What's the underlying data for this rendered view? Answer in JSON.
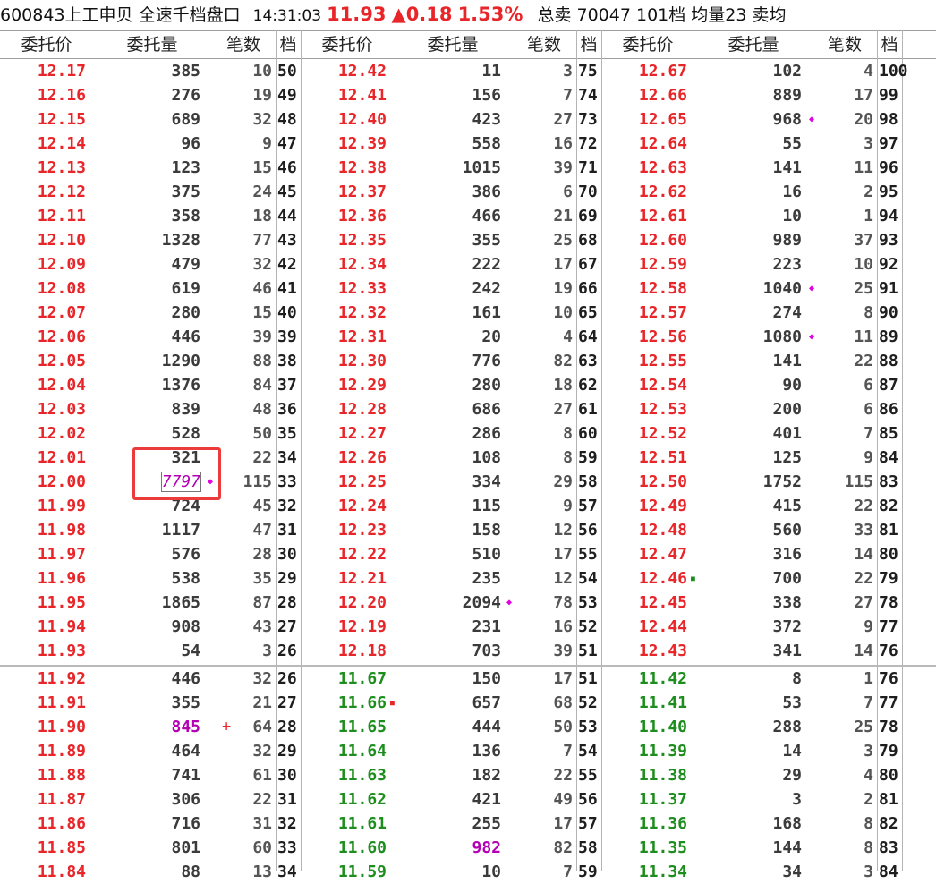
{
  "header": {
    "code": "600843",
    "name": "上工申贝",
    "mode": "全速千档盘口",
    "time": "14:31:03",
    "price": "11.93",
    "change": "▲0.18",
    "pct": "1.53%",
    "info": "总卖 70047 101档 均量23 卖均"
  },
  "columns": {
    "price": "委托价",
    "qty": "委托量",
    "count": "笔数",
    "level": "档"
  },
  "asks": [
    [
      [
        "12.17",
        "385",
        "10",
        "50"
      ],
      [
        "12.42",
        "11",
        "3",
        "75"
      ],
      [
        "12.67",
        "102",
        "4",
        "100"
      ]
    ],
    [
      [
        "12.16",
        "276",
        "19",
        "49"
      ],
      [
        "12.41",
        "156",
        "7",
        "74"
      ],
      [
        "12.66",
        "889",
        "17",
        "99"
      ]
    ],
    [
      [
        "12.15",
        "689",
        "32",
        "48"
      ],
      [
        "12.40",
        "423",
        "27",
        "73"
      ],
      [
        "12.65",
        "968",
        "20",
        "98"
      ]
    ],
    [
      [
        "12.14",
        "96",
        "9",
        "47"
      ],
      [
        "12.39",
        "558",
        "16",
        "72"
      ],
      [
        "12.64",
        "55",
        "3",
        "97"
      ]
    ],
    [
      [
        "12.13",
        "123",
        "15",
        "46"
      ],
      [
        "12.38",
        "1015",
        "39",
        "71"
      ],
      [
        "12.63",
        "141",
        "11",
        "96"
      ]
    ],
    [
      [
        "12.12",
        "375",
        "24",
        "45"
      ],
      [
        "12.37",
        "386",
        "6",
        "70"
      ],
      [
        "12.62",
        "16",
        "2",
        "95"
      ]
    ],
    [
      [
        "12.11",
        "358",
        "18",
        "44"
      ],
      [
        "12.36",
        "466",
        "21",
        "69"
      ],
      [
        "12.61",
        "10",
        "1",
        "94"
      ]
    ],
    [
      [
        "12.10",
        "1328",
        "77",
        "43"
      ],
      [
        "12.35",
        "355",
        "25",
        "68"
      ],
      [
        "12.60",
        "989",
        "37",
        "93"
      ]
    ],
    [
      [
        "12.09",
        "479",
        "32",
        "42"
      ],
      [
        "12.34",
        "222",
        "17",
        "67"
      ],
      [
        "12.59",
        "223",
        "10",
        "92"
      ]
    ],
    [
      [
        "12.08",
        "619",
        "46",
        "41"
      ],
      [
        "12.33",
        "242",
        "19",
        "66"
      ],
      [
        "12.58",
        "1040",
        "25",
        "91"
      ]
    ],
    [
      [
        "12.07",
        "280",
        "15",
        "40"
      ],
      [
        "12.32",
        "161",
        "10",
        "65"
      ],
      [
        "12.57",
        "274",
        "8",
        "90"
      ]
    ],
    [
      [
        "12.06",
        "446",
        "39",
        "39"
      ],
      [
        "12.31",
        "20",
        "4",
        "64"
      ],
      [
        "12.56",
        "1080",
        "11",
        "89"
      ]
    ],
    [
      [
        "12.05",
        "1290",
        "88",
        "38"
      ],
      [
        "12.30",
        "776",
        "82",
        "63"
      ],
      [
        "12.55",
        "141",
        "22",
        "88"
      ]
    ],
    [
      [
        "12.04",
        "1376",
        "84",
        "37"
      ],
      [
        "12.29",
        "280",
        "18",
        "62"
      ],
      [
        "12.54",
        "90",
        "6",
        "87"
      ]
    ],
    [
      [
        "12.03",
        "839",
        "48",
        "36"
      ],
      [
        "12.28",
        "686",
        "27",
        "61"
      ],
      [
        "12.53",
        "200",
        "6",
        "86"
      ]
    ],
    [
      [
        "12.02",
        "528",
        "50",
        "35"
      ],
      [
        "12.27",
        "286",
        "8",
        "60"
      ],
      [
        "12.52",
        "401",
        "7",
        "85"
      ]
    ],
    [
      [
        "12.01",
        "321",
        "22",
        "34"
      ],
      [
        "12.26",
        "108",
        "8",
        "59"
      ],
      [
        "12.51",
        "125",
        "9",
        "84"
      ]
    ],
    [
      [
        "12.00",
        "7797",
        "115",
        "33"
      ],
      [
        "12.25",
        "334",
        "29",
        "58"
      ],
      [
        "12.50",
        "1752",
        "115",
        "83"
      ]
    ],
    [
      [
        "11.99",
        "724",
        "45",
        "32"
      ],
      [
        "12.24",
        "115",
        "9",
        "57"
      ],
      [
        "12.49",
        "415",
        "22",
        "82"
      ]
    ],
    [
      [
        "11.98",
        "1117",
        "47",
        "31"
      ],
      [
        "12.23",
        "158",
        "12",
        "56"
      ],
      [
        "12.48",
        "560",
        "33",
        "81"
      ]
    ],
    [
      [
        "11.97",
        "576",
        "28",
        "30"
      ],
      [
        "12.22",
        "510",
        "17",
        "55"
      ],
      [
        "12.47",
        "316",
        "14",
        "80"
      ]
    ],
    [
      [
        "11.96",
        "538",
        "35",
        "29"
      ],
      [
        "12.21",
        "235",
        "12",
        "54"
      ],
      [
        "12.46",
        "700",
        "22",
        "79"
      ]
    ],
    [
      [
        "11.95",
        "1865",
        "87",
        "28"
      ],
      [
        "12.20",
        "2094",
        "78",
        "53"
      ],
      [
        "12.45",
        "338",
        "27",
        "78"
      ]
    ],
    [
      [
        "11.94",
        "908",
        "43",
        "27"
      ],
      [
        "12.19",
        "231",
        "16",
        "52"
      ],
      [
        "12.44",
        "372",
        "9",
        "77"
      ]
    ],
    [
      [
        "11.93",
        "54",
        "3",
        "26"
      ],
      [
        "12.18",
        "703",
        "39",
        "51"
      ],
      [
        "12.43",
        "341",
        "14",
        "76"
      ]
    ]
  ],
  "bids": [
    [
      [
        "11.92",
        "446",
        "32",
        "26"
      ],
      [
        "11.67",
        "150",
        "17",
        "51"
      ],
      [
        "11.42",
        "8",
        "1",
        "76"
      ]
    ],
    [
      [
        "11.91",
        "355",
        "21",
        "27"
      ],
      [
        "11.66",
        "657",
        "68",
        "52"
      ],
      [
        "11.41",
        "53",
        "7",
        "77"
      ]
    ],
    [
      [
        "11.90",
        "845",
        "64",
        "28"
      ],
      [
        "11.65",
        "444",
        "50",
        "53"
      ],
      [
        "11.40",
        "288",
        "25",
        "78"
      ]
    ],
    [
      [
        "11.89",
        "464",
        "32",
        "29"
      ],
      [
        "11.64",
        "136",
        "7",
        "54"
      ],
      [
        "11.39",
        "14",
        "3",
        "79"
      ]
    ],
    [
      [
        "11.88",
        "741",
        "61",
        "30"
      ],
      [
        "11.63",
        "182",
        "22",
        "55"
      ],
      [
        "11.38",
        "29",
        "4",
        "80"
      ]
    ],
    [
      [
        "11.87",
        "306",
        "22",
        "31"
      ],
      [
        "11.62",
        "421",
        "49",
        "56"
      ],
      [
        "11.37",
        "3",
        "2",
        "81"
      ]
    ],
    [
      [
        "11.86",
        "716",
        "31",
        "32"
      ],
      [
        "11.61",
        "255",
        "17",
        "57"
      ],
      [
        "11.36",
        "168",
        "8",
        "82"
      ]
    ],
    [
      [
        "11.85",
        "801",
        "60",
        "33"
      ],
      [
        "11.60",
        "982",
        "82",
        "58"
      ],
      [
        "11.35",
        "144",
        "8",
        "83"
      ]
    ],
    [
      [
        "11.84",
        "88",
        "13",
        "34"
      ],
      [
        "11.59",
        "10",
        "7",
        "59"
      ],
      [
        "11.34",
        "34",
        "3",
        "84"
      ]
    ]
  ],
  "markers": [
    {
      "side": "asks",
      "row": 2,
      "grp": 2,
      "type": "diamond"
    },
    {
      "side": "asks",
      "row": 9,
      "grp": 2,
      "type": "diamond"
    },
    {
      "side": "asks",
      "row": 11,
      "grp": 2,
      "type": "diamond"
    },
    {
      "side": "asks",
      "row": 17,
      "grp": 0,
      "type": "diamond"
    },
    {
      "side": "asks",
      "row": 21,
      "grp": 2,
      "type": "green-square"
    },
    {
      "side": "asks",
      "row": 22,
      "grp": 1,
      "type": "diamond"
    },
    {
      "side": "bids",
      "row": 1,
      "grp": 1,
      "type": "red-square"
    },
    {
      "side": "bids",
      "row": 2,
      "grp": 0,
      "type": "plus"
    }
  ],
  "magenta_qty": [
    {
      "side": "asks",
      "row": 17,
      "grp": 0
    },
    {
      "side": "bids",
      "row": 2,
      "grp": 0
    },
    {
      "side": "bids",
      "row": 7,
      "grp": 1
    }
  ],
  "boxed_qty": [
    {
      "side": "asks",
      "row": 17,
      "grp": 0
    }
  ],
  "colors": {
    "up": "#e8262a",
    "down": "#1d8e1d",
    "highlight": "#b400b4",
    "marker": "#e000e0"
  }
}
